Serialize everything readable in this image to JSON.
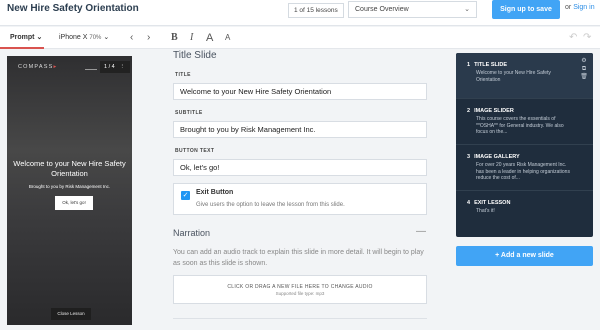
{
  "header": {
    "title": "New Hire Safety Orientation",
    "lesson_count": "1 of 15 lessons",
    "course_select": "Course Overview",
    "signup_label": "Sign up to save",
    "or_label": "or",
    "signin_label": "Sign in"
  },
  "toolbar": {
    "prompt_label": "Prompt",
    "device_label": "iPhone X",
    "zoom": "70%"
  },
  "preview": {
    "logo": "COMPASS",
    "counter": "1 / 4",
    "title": "Welcome to your New Hire Safety Orientation",
    "subtitle": "Brought to you by Risk Management Inc.",
    "button": "Ok, let's go!",
    "close": "Close Lesson"
  },
  "form": {
    "section_title": "Title Slide",
    "title_label": "TITLE",
    "title_value": "Welcome to your New Hire Safety Orientation",
    "subtitle_label": "SUBTITLE",
    "subtitle_value": "Brought to you by Risk Management Inc.",
    "button_label": "BUTTON TEXT",
    "button_value": "Ok, let's go!",
    "exit_title": "Exit Button",
    "exit_desc": "Give users the option to leave the lesson from this slide.",
    "exit_checked": true
  },
  "narration": {
    "title": "Narration",
    "desc": "You can add an audio track to explain this slide in more detail. It will begin to play as soon as this slide is shown.",
    "dropzone_main": "CLICK OR DRAG A NEW FILE HERE TO CHANGE AUDIO",
    "dropzone_sub": "Supported file type: mp3"
  },
  "slides": [
    {
      "num": "1",
      "title": "TITLE SLIDE",
      "desc": "Welcome to your New Hire Safety Orientation"
    },
    {
      "num": "2",
      "title": "IMAGE SLIDER",
      "desc": "This course covers the essentials of **OSHA** for General industry. We also focus on the..."
    },
    {
      "num": "3",
      "title": "IMAGE GALLERY",
      "desc": "For over 20 years Risk Management Inc. has been a leader in helping organizations reduce the cost of..."
    },
    {
      "num": "4",
      "title": "EXIT LESSON",
      "desc": "That's it!"
    }
  ],
  "add_slide_label": "+ Add a new slide"
}
